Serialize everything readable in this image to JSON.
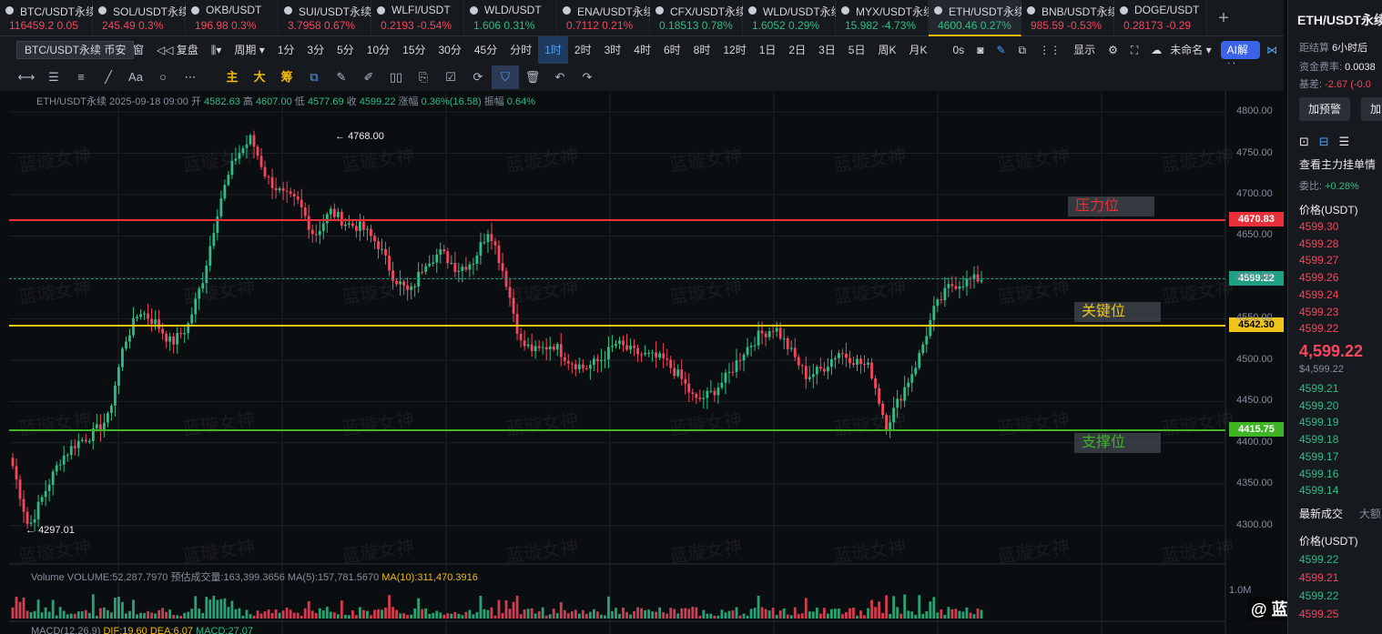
{
  "tabs": [
    {
      "name": "BTC/USDT永续",
      "price": "116459.2",
      "change": "0.05",
      "dir": "down"
    },
    {
      "name": "SOL/USDT永续",
      "price": "245.49",
      "change": "0.3%",
      "dir": "down"
    },
    {
      "name": "OKB/USDT",
      "price": "196.98",
      "change": "0.3%",
      "dir": "down"
    },
    {
      "name": "SUI/USDT永续",
      "price": "3.7958",
      "change": "0.67%",
      "dir": "down"
    },
    {
      "name": "WLFI/USDT",
      "price": "0.2193",
      "change": "-0.54%",
      "dir": "down"
    },
    {
      "name": "WLD/USDT",
      "price": "1.606",
      "change": "0.31%",
      "dir": "up"
    },
    {
      "name": "ENA/USDT永续",
      "price": "0.7112",
      "change": "0.21%",
      "dir": "down"
    },
    {
      "name": "CFX/USDT永续",
      "price": "0.18513",
      "change": "0.78%",
      "dir": "up"
    },
    {
      "name": "WLD/USDT永续",
      "price": "1.6052",
      "change": "0.29%",
      "dir": "up"
    },
    {
      "name": "MYX/USDT永续",
      "price": "15.982",
      "change": "-4.73%",
      "dir": "up"
    },
    {
      "name": "ETH/USDT永续",
      "price": "4600.46",
      "change": "0.27%",
      "dir": "up",
      "active": true
    },
    {
      "name": "BNB/USDT永续",
      "price": "985.59",
      "change": "-0.53%",
      "dir": "down"
    },
    {
      "name": "DOGE/USDT",
      "price": "0.28173",
      "change": "-0.29",
      "dir": "down"
    }
  ],
  "tab_add": "+",
  "toolbar": {
    "symbol_tip": "BTC/USDT永续 币安",
    "multi_window": "多窗",
    "replay": "复盘",
    "period": "周期",
    "intervals": [
      "1分",
      "3分",
      "5分",
      "10分",
      "15分",
      "30分",
      "45分",
      "分时",
      "1时",
      "2时",
      "3时",
      "4时",
      "6时",
      "8时",
      "12时",
      "1日",
      "2日",
      "3日",
      "5日",
      "周K",
      "月K"
    ],
    "active_interval": "1时",
    "countdown": "0s",
    "display": "显示",
    "unnamed": "未命名",
    "ai": "AI解读"
  },
  "drawbar": {
    "tools": [
      "⟷",
      "☰",
      "≡",
      "╱",
      "Aa",
      "○",
      "⋯"
    ],
    "zhu": "主",
    "da": "大",
    "chou": "筹",
    "right_tools": [
      "⧉",
      "✎",
      "✐",
      "▯▯",
      "⎘",
      "☑",
      "⟳",
      "⛉",
      "🗑",
      "↶",
      "↷"
    ]
  },
  "ohlc": {
    "symbol": "ETH/USDT永续",
    "datetime": "2025-09-18 09:00",
    "open_label": "开",
    "open": "4582.63",
    "high_label": "高",
    "high": "4607.00",
    "low_label": "低",
    "low": "4577.69",
    "close_label": "收",
    "close": "4599.22",
    "chg_label": "涨幅",
    "chg": "0.36%(16.58)",
    "amp_label": "振幅",
    "amp": "0.64%"
  },
  "watermark": "蓝璇女神",
  "levels": {
    "resistance": {
      "label": "压力位",
      "price": "4670.83",
      "color": "#e8313b"
    },
    "key": {
      "label": "关键位",
      "price": "4542.30",
      "color": "#f0c419"
    },
    "support": {
      "label": "支撑位",
      "price": "4415.75",
      "color": "#3fb425"
    },
    "current": {
      "price": "4599.22",
      "color": "#1fa085"
    }
  },
  "high_marker": "4768.00",
  "low_marker": "4297.01",
  "volume_info": {
    "text": "Volume VOLUME:52,287.7970 预估成交量:163,399.3656",
    "ma5": "MA(5):157,781.5670",
    "ma10": "MA(10):311,470.3916"
  },
  "macd_info": {
    "label": "MACD(12,26,9)",
    "dif": "DIF:19.60",
    "dea": "DEA:6.07",
    "macd": "MACD:27.07"
  },
  "vol_scale": "1.0M",
  "brand": "@ 蓝璇女神",
  "chart_data": {
    "type": "candlestick",
    "ylim": [
      4270,
      4810
    ],
    "yticks": [
      4300,
      4350,
      4400,
      4450,
      4500,
      4550,
      4600,
      4650,
      4700,
      4750,
      4800
    ],
    "ytick_labels": [
      "4300.00",
      "4350.00",
      "4400.00",
      "4450.00",
      "4500.00",
      "4550.00",
      "4600.00",
      "4650.00",
      "4700.00",
      "4750.00",
      "4800.00"
    ],
    "colors": {
      "up": "#2ebd85",
      "down": "#f6465d"
    },
    "waypoints": [
      4372,
      4297,
      4340,
      4380,
      4400,
      4410,
      4430,
      4520,
      4560,
      4545,
      4520,
      4540,
      4600,
      4690,
      4745,
      4768,
      4720,
      4700,
      4690,
      4650,
      4680,
      4665,
      4660,
      4640,
      4600,
      4580,
      4620,
      4630,
      4610,
      4620,
      4660,
      4600,
      4520,
      4510,
      4520,
      4500,
      4490,
      4500,
      4520,
      4510,
      4505,
      4500,
      4480,
      4450,
      4460,
      4480,
      4510,
      4530,
      4540,
      4510,
      4480,
      4490,
      4510,
      4500,
      4490,
      4420,
      4460,
      4500,
      4560,
      4590,
      4595,
      4599
    ]
  },
  "panel": {
    "title": "ETH/USDT永续",
    "settle_label": "距结算",
    "settle": "6小时后",
    "funding_label": "资金费率:",
    "funding": "0.0038",
    "basis_label": "基差:",
    "basis": "-2.67 (-0.0",
    "alert_btn": "加预警",
    "add_btn": "加自",
    "orders_title": "查看主力挂单情",
    "ratio_label": "委比:",
    "ratio": "+0.28%",
    "price_header": "价格(USDT)",
    "asks": [
      "4599.30",
      "4599.28",
      "4599.27",
      "4599.26",
      "4599.24",
      "4599.23",
      "4599.22"
    ],
    "last": "4,599.22",
    "mark": "$4,599.22",
    "bids": [
      "4599.21",
      "4599.20",
      "4599.19",
      "4599.18",
      "4599.17",
      "4599.16",
      "4599.14"
    ],
    "trades_title": "最新成交",
    "trades_tab2": "大额",
    "trades_header": "价格(USDT)",
    "trades": [
      "4599.22",
      "4599.21",
      "4599.22",
      "4599.25"
    ]
  }
}
